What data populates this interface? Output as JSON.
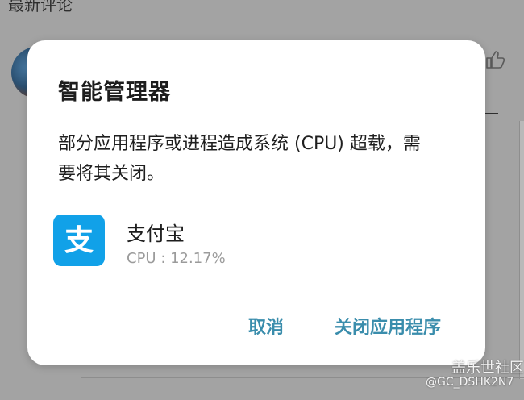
{
  "background": {
    "header_text": "最新评论"
  },
  "dialog": {
    "title": "智能管理器",
    "message": "部分应用程序或进程造成系统 (CPU) 超载，需要将其关闭。",
    "app": {
      "name": "支付宝",
      "cpu_text": "CPU : 12.17%",
      "icon_glyph": "支",
      "icon_color": "#11a1e8"
    },
    "buttons": {
      "cancel": "取消",
      "close_app": "关闭应用程序"
    }
  },
  "watermark": {
    "brand": "盖乐世社区",
    "user": "@GC_DSHK2N7"
  },
  "colors": {
    "accent": "#3a8dac",
    "scrim": "#a3a3a3",
    "dialog_bg": "#ffffff"
  }
}
